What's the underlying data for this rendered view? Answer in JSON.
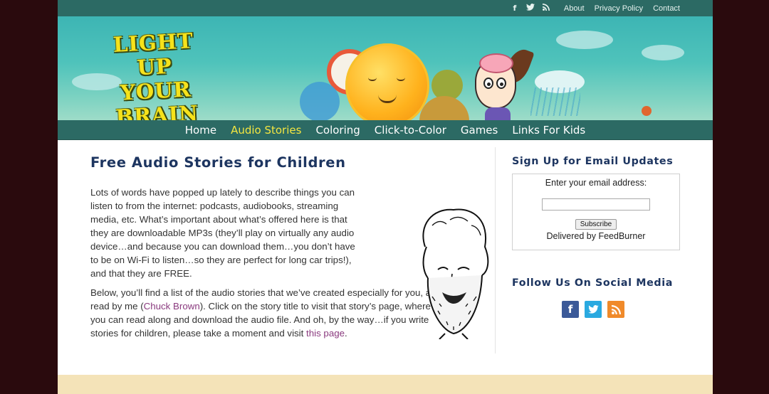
{
  "topbar": {
    "icons": [
      "facebook-icon",
      "twitter-icon",
      "rss-icon"
    ],
    "links": [
      "About",
      "Privacy Policy",
      "Contact"
    ]
  },
  "banner": {
    "logo_line1": "LIGHT UP",
    "logo_line2": "YOUR",
    "logo_line3": "BRAIN"
  },
  "nav": {
    "items": [
      "Home",
      "Audio Stories",
      "Coloring",
      "Click-to-Color",
      "Games",
      "Links For Kids"
    ],
    "active_index": 1,
    "active_color": "#f4e640"
  },
  "main": {
    "title": "Free Audio Stories for Children",
    "para1": "Lots of words have popped up lately to describe things you can listen to from the internet: podcasts, audiobooks, streaming media, etc. What’s important about what’s offered here is that they are downloadable MP3s (they’ll play on virtually any audio device…and because you can download them…you don’t have to be on Wi-Fi to listen…so they are perfect for long car trips!), and that they are FREE.",
    "para2_before": "Below, you’ll find a list of the audio stories that we’ve created especially for you, all read by me (",
    "para2_link1": "Chuck Brown",
    "para2_middle": "). Click on the story title to visit that story’s page, where you can read along and download the audio file. And oh, by the way…if you write stories for children, please take a moment and visit ",
    "para2_link2": "this page",
    "para2_end": "."
  },
  "sidebar": {
    "signup_title": "Sign Up for Email Updates",
    "email_label": "Enter your email address:",
    "subscribe_label": "Subscribe",
    "delivered_by": "Delivered by FeedBurner",
    "follow_title": "Follow Us On Social Media",
    "social_icons": [
      "facebook-icon",
      "twitter-icon",
      "rss-icon"
    ]
  },
  "colors": {
    "teal_bar": "#2c6a64",
    "heading": "#1d3560",
    "link": "#8a3a7e",
    "outer_bg": "#2a0a0d"
  }
}
